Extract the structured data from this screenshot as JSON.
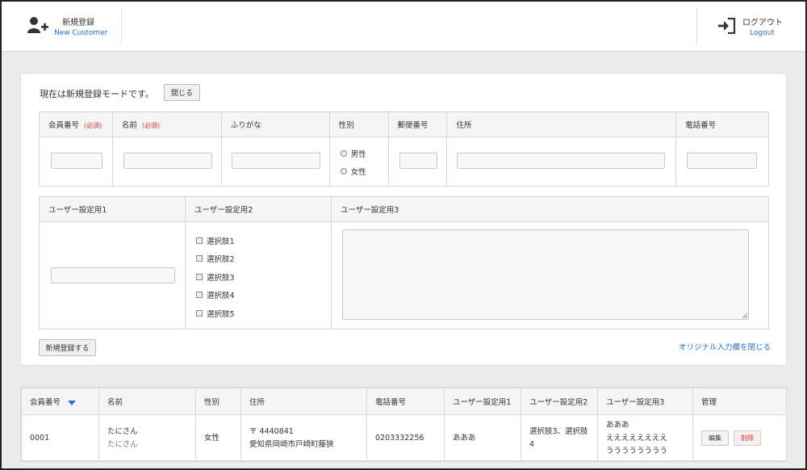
{
  "header": {
    "new_label": "新規登録",
    "new_sub": "New Customer",
    "logout_label": "ログアウト",
    "logout_sub": "Logout"
  },
  "form": {
    "mode_text": "現在は新規登録モードです。",
    "close_button": "閉じる",
    "required": "(必須)",
    "columns": [
      "会員番号",
      "名前",
      "ふりがな",
      "性別",
      "郵便番号",
      "住所",
      "電話番号"
    ],
    "gender_options": [
      "男性",
      "女性"
    ],
    "user_columns": [
      "ユーザー設定用1",
      "ユーザー設定用2",
      "ユーザー設定用3"
    ],
    "choices": [
      "選択肢1",
      "選択肢2",
      "選択肢3",
      "選択肢4",
      "選択肢5"
    ],
    "submit_button": "新規登録する",
    "close_original_link": "オリジナル入力欄を閉じる"
  },
  "list": {
    "columns": [
      "会員番号",
      "名前",
      "性別",
      "住所",
      "電話番号",
      "ユーザー設定用1",
      "ユーザー設定用2",
      "ユーザー設定用3",
      "管理"
    ],
    "rows": [
      {
        "id": "0001",
        "name": "たにさん",
        "kana": "たにさん",
        "gender": "女性",
        "zip": "〒 4440841",
        "address": "愛知県岡崎市戸崎町藤狭",
        "phone": "0203332256",
        "user1": "あああ",
        "user2": "選択肢3、選択肢4",
        "user3_lines": [
          "あああ",
          "ええええええええ",
          "うううううううう"
        ],
        "edit": "編集",
        "delete": "削除"
      }
    ]
  },
  "colors": {
    "accent": "#2a6fc9",
    "required": "#d9372f"
  }
}
